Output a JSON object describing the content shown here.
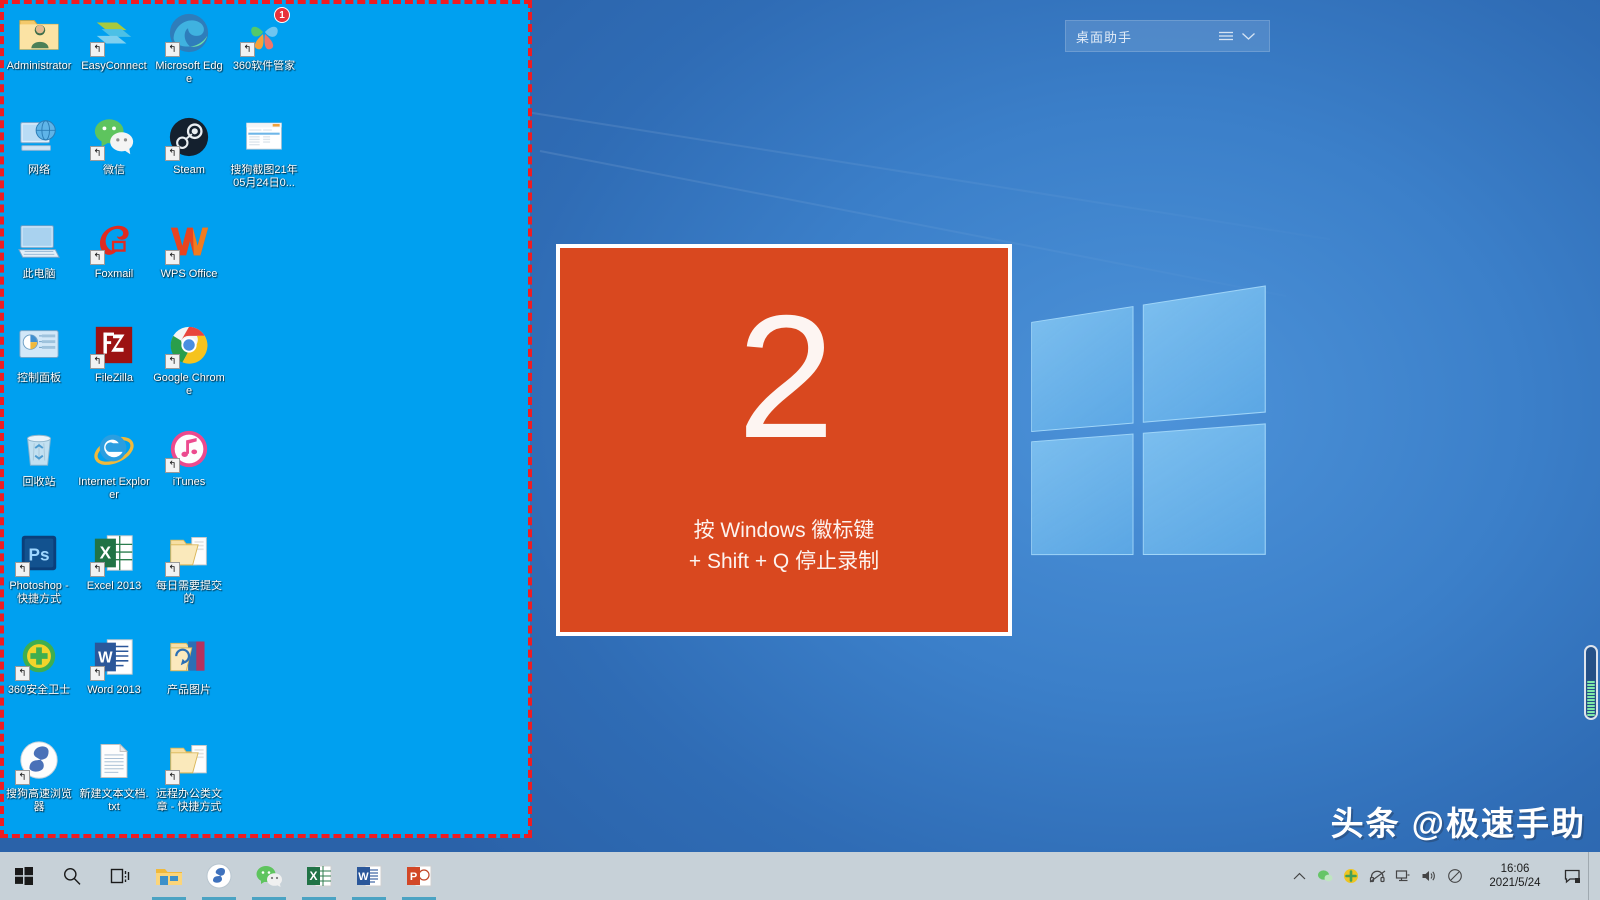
{
  "desktop": {
    "icons": [
      {
        "label": "Administrator",
        "art": "folder-user",
        "shortcut": false,
        "badge": null
      },
      {
        "label": "EasyConnect",
        "art": "easyconnect",
        "shortcut": true,
        "badge": null
      },
      {
        "label": "Microsoft Edge",
        "art": "edge",
        "shortcut": true,
        "badge": null
      },
      {
        "label": "360软件管家",
        "art": "360-software",
        "shortcut": true,
        "badge": "1"
      },
      {
        "label": "网络",
        "art": "network",
        "shortcut": false,
        "badge": null
      },
      {
        "label": "微信",
        "art": "wechat",
        "shortcut": true,
        "badge": null
      },
      {
        "label": "Steam",
        "art": "steam",
        "shortcut": true,
        "badge": null
      },
      {
        "label": "搜狗截图21年05月24日0...",
        "art": "screenshot-image",
        "shortcut": false,
        "badge": null
      },
      {
        "label": "此电脑",
        "art": "this-pc",
        "shortcut": false,
        "badge": null
      },
      {
        "label": "Foxmail",
        "art": "foxmail",
        "shortcut": true,
        "badge": null
      },
      {
        "label": "WPS Office",
        "art": "wps-office",
        "shortcut": true,
        "badge": null
      },
      {
        "label": "",
        "art": "none",
        "shortcut": false,
        "badge": null
      },
      {
        "label": "控制面板",
        "art": "control-panel",
        "shortcut": false,
        "badge": null
      },
      {
        "label": "FileZilla",
        "art": "filezilla",
        "shortcut": true,
        "badge": null
      },
      {
        "label": "Google Chrome",
        "art": "chrome",
        "shortcut": true,
        "badge": null
      },
      {
        "label": "",
        "art": "none",
        "shortcut": false,
        "badge": null
      },
      {
        "label": "回收站",
        "art": "recycle-bin",
        "shortcut": false,
        "badge": null
      },
      {
        "label": "Internet Explorer",
        "art": "internet-explorer",
        "shortcut": false,
        "badge": null
      },
      {
        "label": "iTunes",
        "art": "itunes",
        "shortcut": true,
        "badge": null
      },
      {
        "label": "",
        "art": "none",
        "shortcut": false,
        "badge": null
      },
      {
        "label": "Photoshop - 快捷方式",
        "art": "photoshop",
        "shortcut": true,
        "badge": null
      },
      {
        "label": "Excel 2013",
        "art": "excel",
        "shortcut": true,
        "badge": null
      },
      {
        "label": "每日需要提交的",
        "art": "folder-open",
        "shortcut": true,
        "badge": null
      },
      {
        "label": "",
        "art": "none",
        "shortcut": false,
        "badge": null
      },
      {
        "label": "360安全卫士",
        "art": "360-safe",
        "shortcut": true,
        "badge": null
      },
      {
        "label": "Word 2013",
        "art": "word",
        "shortcut": true,
        "badge": null
      },
      {
        "label": "产品图片",
        "art": "folder-book",
        "shortcut": false,
        "badge": null
      },
      {
        "label": "",
        "art": "none",
        "shortcut": false,
        "badge": null
      },
      {
        "label": "搜狗高速浏览器",
        "art": "sogou-browser",
        "shortcut": true,
        "badge": null
      },
      {
        "label": "新建文本文档.txt",
        "art": "text-file",
        "shortcut": false,
        "badge": null
      },
      {
        "label": "远程办公类文章 - 快捷方式",
        "art": "folder-open",
        "shortcut": true,
        "badge": null
      },
      {
        "label": "",
        "art": "none",
        "shortcut": false,
        "badge": null
      }
    ]
  },
  "desktop_assistant": {
    "title": "桌面助手",
    "menu_icon": "hamburger-menu-icon",
    "collapse_icon": "chevron-down-icon"
  },
  "recording_overlay": {
    "countdown": "2",
    "hint_line1": "按 Windows 徽标键",
    "hint_line2": "+ Shift + Q 停止录制",
    "background_color": "#d9481f",
    "border_color": "#ffffff"
  },
  "selection": {
    "border_color": "#ee1c22",
    "style": "dashed"
  },
  "watermark": {
    "text": "头条 @极速手助"
  },
  "taskbar": {
    "start_label": "start-button",
    "search_label": "search-icon",
    "taskview_label": "task-view-icon",
    "apps": [
      {
        "name": "file-explorer",
        "active": true
      },
      {
        "name": "sogou-browser",
        "active": true
      },
      {
        "name": "wechat",
        "active": true
      },
      {
        "name": "excel",
        "active": true
      },
      {
        "name": "word",
        "active": true
      },
      {
        "name": "powerpoint",
        "active": true
      }
    ],
    "tray": [
      {
        "name": "show-hidden-icons-icon",
        "glyph": "⌃"
      },
      {
        "name": "wechat-tray-icon",
        "glyph": ""
      },
      {
        "name": "360-shield-tray-icon",
        "glyph": ""
      },
      {
        "name": "headset-muted-icon",
        "glyph": ""
      },
      {
        "name": "network-icon",
        "glyph": ""
      },
      {
        "name": "volume-icon",
        "glyph": ""
      },
      {
        "name": "mute-mic-icon",
        "glyph": ""
      }
    ],
    "clock": {
      "time": "16:06",
      "date": "2021/5/24"
    },
    "action_center_icon": "action-center-icon"
  }
}
